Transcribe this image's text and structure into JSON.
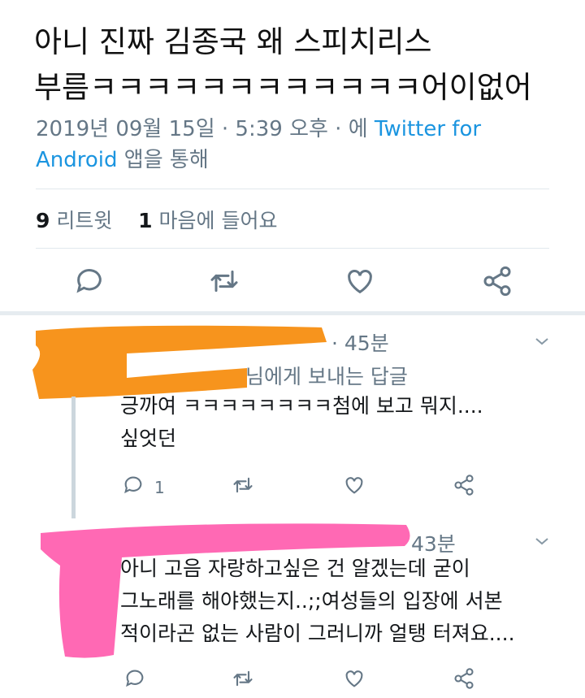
{
  "tweet": {
    "line1": "아니 진짜 김종국 왜 스피치리스",
    "line2": "부름ㅋㅋㅋㅋㅋㅋㅋㅋㅋㅋㅋㅋ어이없어",
    "date": "2019년 09월 15일 · 5:39 오후 · 에 ",
    "via_link": "Twitter for",
    "via_link2": "Android",
    "via_suffix": " 앱을 통해",
    "retweet_count": "9",
    "retweet_label": "리트윗",
    "like_count": "1",
    "like_label": "마음에 들어요"
  },
  "actions": {
    "icons": [
      "reply-icon",
      "retweet-icon",
      "like-icon",
      "share-icon"
    ]
  },
  "replies": [
    {
      "time": "· 45분",
      "reply_to": "님에게 보내는 답글",
      "text_line1": "긍까여 ㅋㅋㅋㅋㅋㅋㅋㅋ첨에 보고 뭐지....",
      "text_line2": "싶엇던",
      "reply_count": "1",
      "redaction_color": "#f7941d"
    },
    {
      "time": "43분",
      "text_line1": "아니 고음 자랑하고싶은 건 알겠는데 굳이",
      "text_line2": "그노래를 해야했는지..;;여성들의 입장에 서본",
      "text_line3": "적이라곤 없는 사람이 그러니까 얼탱 터져요....",
      "redaction_color": "#ff69b4"
    }
  ],
  "colors": {
    "link": "#1b95e0",
    "muted": "#657786",
    "icon": "#657786"
  }
}
